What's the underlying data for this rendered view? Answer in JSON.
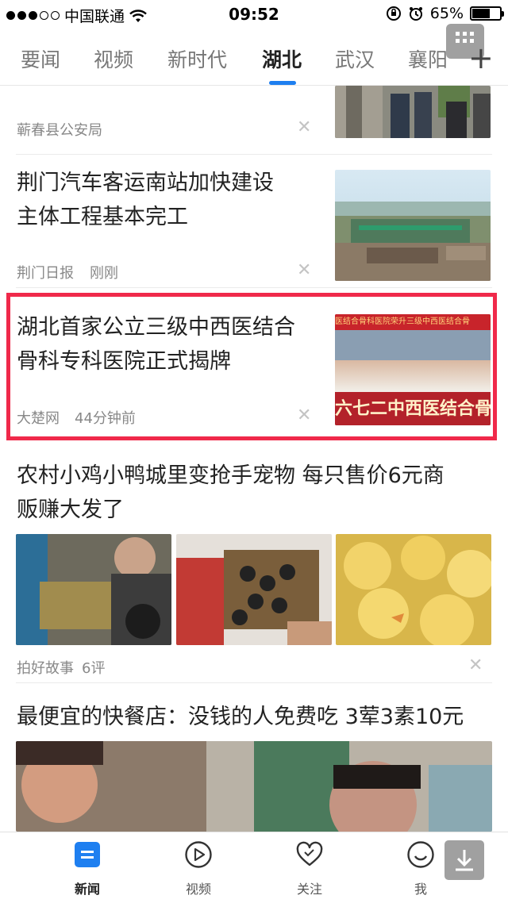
{
  "status_bar": {
    "carrier": "中国联通",
    "time": "09:52",
    "battery_percent": "65%",
    "battery_level": 0.65
  },
  "tabs": [
    {
      "label": "要闻",
      "active": false
    },
    {
      "label": "视频",
      "active": false
    },
    {
      "label": "新时代",
      "active": false
    },
    {
      "label": "湖北",
      "active": true
    },
    {
      "label": "武汉",
      "active": false
    },
    {
      "label": "襄阳",
      "active": false
    }
  ],
  "feed": {
    "items": [
      {
        "source": "蕲春县公安局"
      },
      {
        "title_line1": "荆门汽车客运南站加快建设",
        "title_line2": "主体工程基本完工",
        "source": "荆门日报",
        "time": "刚刚"
      },
      {
        "title_line1": "湖北首家公立三级中西医结合",
        "title_line2": "骨科专科医院正式揭牌",
        "source": "大楚网",
        "time": "44分钟前",
        "banner_top": "医结合骨科医院荣升三级中西医结合骨",
        "banner_bottom": "六七二中西医结合骨"
      },
      {
        "title_line1": "农村小鸡小鸭城里变抢手宠物 每只售价6元商",
        "title_line2": "贩赚大发了",
        "source": "拍好故事",
        "comments": "6评"
      },
      {
        "title": "最便宜的快餐店：没钱的人免费吃 3荤3素10元"
      }
    ],
    "close_glyph": "✕"
  },
  "bottom_nav": [
    {
      "label": "新闻",
      "active": true
    },
    {
      "label": "视频",
      "active": false
    },
    {
      "label": "关注",
      "active": false
    },
    {
      "label": "我",
      "active": false
    }
  ],
  "colors": {
    "accent": "#1e7ff0",
    "highlight_border": "#f0294a"
  }
}
